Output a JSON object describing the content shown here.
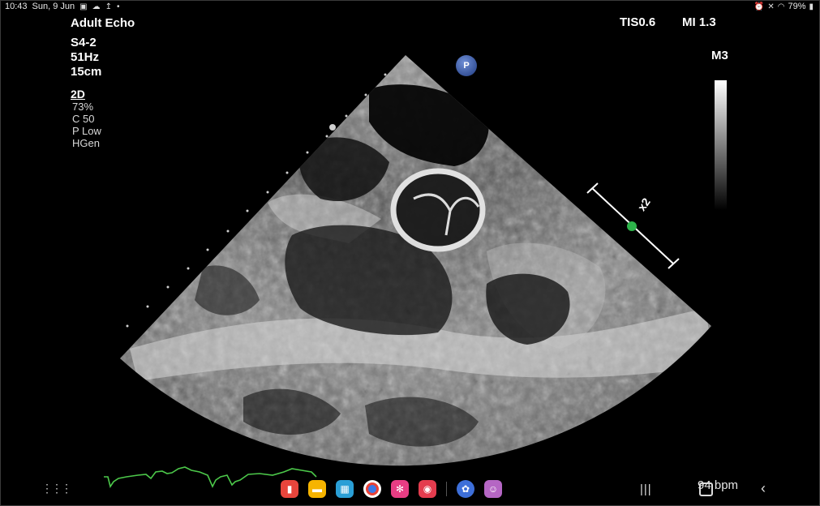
{
  "status_bar": {
    "time": "10:43",
    "date": "Sun, 9 Jun",
    "battery": "79%"
  },
  "echo": {
    "preset": "Adult Echo",
    "probe": "S4-2",
    "frame_rate": "51Hz",
    "depth": "15cm",
    "mode": {
      "title": "2D",
      "lines": [
        "73%",
        "C 50",
        "P Low",
        "HGen"
      ]
    },
    "tis": "TIS0.6",
    "mi": "MI 1.3",
    "map": "M3",
    "p_badge": "P",
    "zoom": "x2",
    "heart_rate": "94 bpm"
  },
  "nav": {
    "apps": "⋮⋮⋮",
    "recents": "|||",
    "back": "‹"
  },
  "dock_apps": [
    {
      "name": "notes-app",
      "color": "#e8453c"
    },
    {
      "name": "files-app",
      "color": "#f6b400"
    },
    {
      "name": "calendar-app",
      "color": "#2a9fd6"
    },
    {
      "name": "chrome-app",
      "color": "#ffffff"
    },
    {
      "name": "flower-app",
      "color": "#e83d84"
    },
    {
      "name": "camera-app",
      "color": "#e43c4e"
    },
    {
      "name": "assistant-app",
      "color": "#3d6fd9"
    },
    {
      "name": "profile-app",
      "color": "#b566c4"
    }
  ]
}
